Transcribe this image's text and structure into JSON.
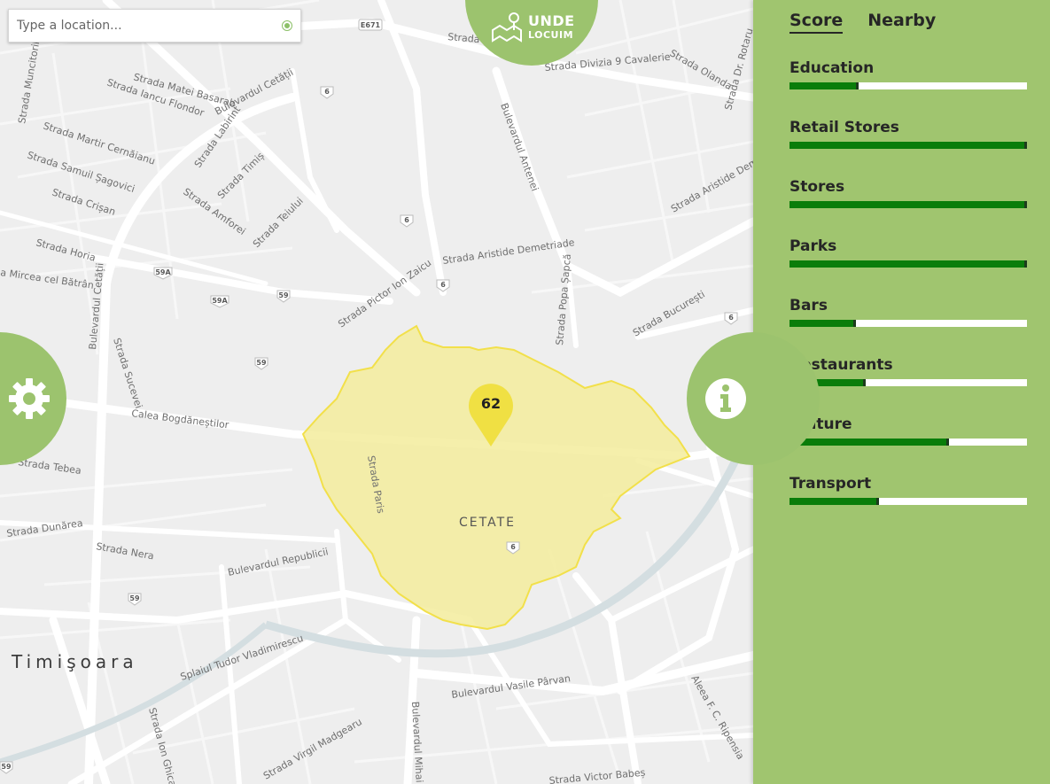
{
  "search": {
    "placeholder": "Type a location..."
  },
  "logo": {
    "line1": "UNDE",
    "line2": "LOCUIM"
  },
  "map": {
    "city": "Timişoara",
    "district": "CETATE",
    "pin_value": "62",
    "streets": [
      "Strada Matei Basarab",
      "Strada Iancu Flondor",
      "Bulevardul Cetății",
      "Strada Martir Cernăianu",
      "Strada Samuil Șagovici",
      "Strada Crișan",
      "Strada Labirint",
      "Strada Timiș",
      "Strada Amforei",
      "Strada Teiului",
      "Strada Horia",
      "Strada Mircea cel Bătrân",
      "Strada Pictor Ion Zaicu",
      "Strada Aristide Demetriade",
      "Strada Popa Șapcă",
      "Strada București",
      "Bulevardul Antenei",
      "Strada Divizia 9 Cavalerie",
      "Strada Olanda",
      "Strada Dr. Rotaru",
      "Strada Ioan Slavici",
      "Calea Bogdăneștilor",
      "Strada Sucevei",
      "Strada Tebea",
      "Strada Dunărea",
      "Strada Nera",
      "Bulevardul Republicii",
      "Strada Paris",
      "Splaiul Tudor Vladimirescu",
      "Strada Ion Ghica",
      "Strada Virgil Madgearu",
      "Bulevardul Mihai Viteazu",
      "Strada Victor Babeș",
      "Bulevardul Vasile Pârvan",
      "Aleea F. C. Ripensia",
      "Strada Muncitorilor",
      "Strada Amurgului",
      "Strada Căluțului",
      "Strada Aristide Demetriade"
    ],
    "shields": [
      "E671",
      "6",
      "6",
      "59A",
      "59A",
      "59",
      "59",
      "59",
      "6",
      "6",
      "6",
      "59",
      "59"
    ]
  },
  "panel": {
    "tabs": [
      {
        "label": "Score",
        "active": true
      },
      {
        "label": "Nearby",
        "active": false
      }
    ],
    "metrics": [
      {
        "label": "Education",
        "score": 0.29
      },
      {
        "label": "Retail Stores",
        "score": 1.0
      },
      {
        "label": "Stores",
        "score": 1.0
      },
      {
        "label": "Parks",
        "score": 1.0
      },
      {
        "label": "Bars",
        "score": 0.28
      },
      {
        "label": "Restaurants",
        "score": 0.32
      },
      {
        "label": "Culture",
        "score": 0.67
      },
      {
        "label": "Transport",
        "score": 0.375
      }
    ]
  },
  "colors": {
    "accent": "#9cc36e",
    "panel": "#a0c56f",
    "bar_fill": "#0a7d0a",
    "area_fill": "#f4eea0",
    "area_stroke": "#f2e04a",
    "pin": "#f0e043"
  },
  "icons": {
    "settings": "gear-icon",
    "info": "info-icon",
    "gps": "locate-icon",
    "logo": "map-pin-icon"
  }
}
